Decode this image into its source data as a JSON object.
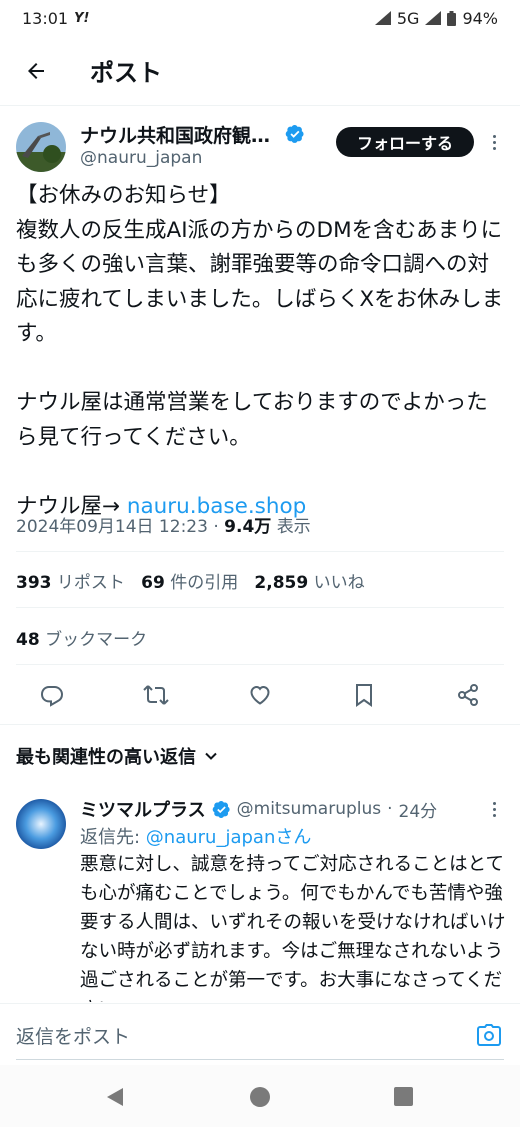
{
  "status_bar": {
    "time": "13:01",
    "carrier_icon": "Y!",
    "network": "5G",
    "battery": "94%"
  },
  "header": {
    "title": "ポスト"
  },
  "post": {
    "author_name": "ナウル共和国政府観…",
    "handle": "@nauru_japan",
    "follow_label": "フォローする",
    "body_text": "【お休みのお知らせ】\n複数人の反生成AI派の方からのDMを含むあまりにも多くの強い言葉、謝罪強要等の命令口調への対応に疲れてしまいました。しばらくXをお休みします。\n\nナウル屋は通常営業をしておりますのでよかったら見て行ってください。\n\n",
    "link_prefix": "ナウル屋→ ",
    "link_text": "nauru.base.shop",
    "datetime": "2024年09月14日 12:23",
    "views_count": "9.4万",
    "views_label": "表示",
    "reposts_count": "393",
    "reposts_label": "リポスト",
    "quotes_count": "69",
    "quotes_label": "件の引用",
    "likes_count": "2,859",
    "likes_label": "いいね",
    "bookmarks_count": "48",
    "bookmarks_label": "ブックマーク"
  },
  "replies": {
    "sort_label": "最も関連性の高い返信",
    "items": [
      {
        "name": "ミツマルプラス",
        "handle": "@mitsumaruplus",
        "time": "24分",
        "reply_to_prefix": "返信先: ",
        "reply_to_handle": "@nauru_japanさん",
        "text": "悪意に対し、誠意を持ってご対応されることはとても心が痛むことでしょう。何でもかんでも苦情や強要する人間は、いずれその報いを受けなければいけない時が必ず訪れます。今はご無理なされないよう過ごされることが第一です。お大事になさってください。"
      }
    ]
  },
  "composer": {
    "placeholder": "返信をポスト"
  },
  "colors": {
    "accent": "#1d9bf0",
    "verified": "#1d9bf0",
    "text": "#0f1419",
    "muted": "#536471"
  }
}
